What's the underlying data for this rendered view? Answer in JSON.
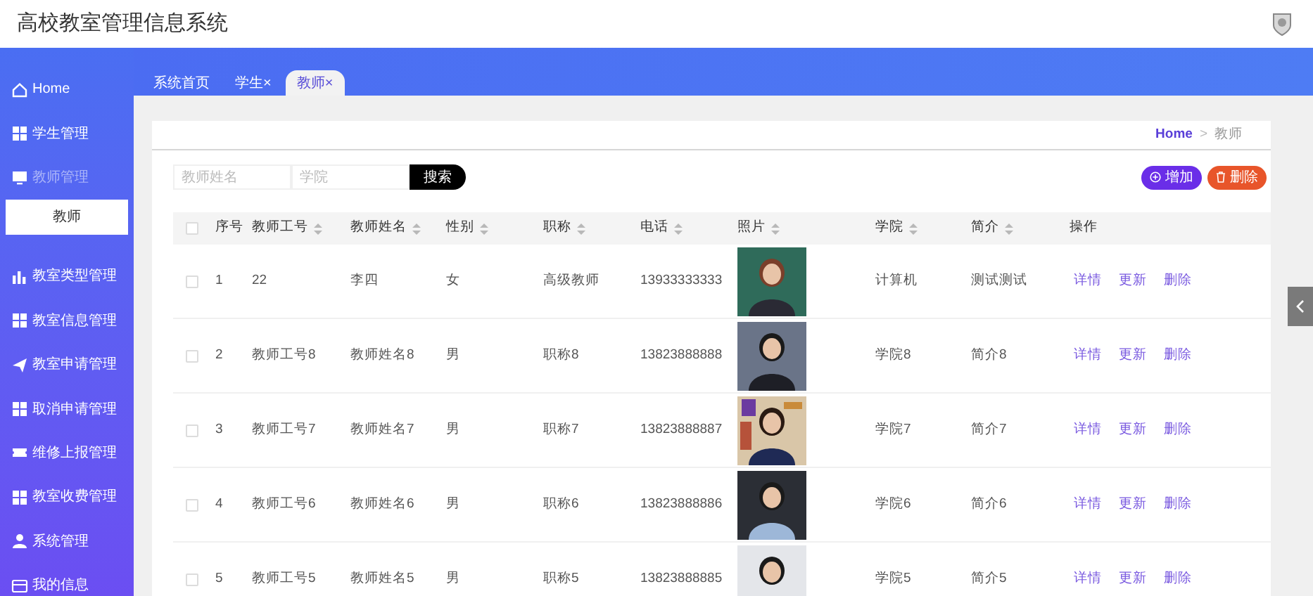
{
  "header": {
    "title": "高校教室管理信息系统"
  },
  "sidebar": {
    "items": [
      {
        "label": "Home",
        "expanded": false
      },
      {
        "label": "学生管理",
        "expanded": false
      },
      {
        "label": "教师管理",
        "expanded": true,
        "children": [
          {
            "label": "教师",
            "selected": true
          }
        ]
      },
      {
        "label": "教室类型管理",
        "expanded": false
      },
      {
        "label": "教室信息管理",
        "expanded": false
      },
      {
        "label": "教室申请管理",
        "expanded": false
      },
      {
        "label": "取消申请管理",
        "expanded": false
      },
      {
        "label": "维修上报管理",
        "expanded": false
      },
      {
        "label": "教室收费管理",
        "expanded": false
      },
      {
        "label": "系统管理",
        "expanded": false
      },
      {
        "label": "我的信息",
        "expanded": false
      }
    ]
  },
  "tabs": [
    {
      "label": "系统首页",
      "selected": false
    },
    {
      "label": "学生",
      "close": "×",
      "selected": false
    },
    {
      "label": "教师",
      "close": "×",
      "selected": true
    }
  ],
  "breadcrumb": {
    "home": "Home",
    "separator": ">",
    "current": "教师"
  },
  "search": {
    "fields": [
      {
        "placeholder": "教师姓名"
      },
      {
        "placeholder": "学院"
      }
    ],
    "button": "搜索"
  },
  "actions": {
    "add": "增加",
    "delete": "删除"
  },
  "table": {
    "header_checked": false,
    "columns": [
      {
        "label": "序号",
        "sortable": false
      },
      {
        "label": "教师工号",
        "sortable": true
      },
      {
        "label": "教师姓名",
        "sortable": true
      },
      {
        "label": "性别",
        "sortable": true
      },
      {
        "label": "职称",
        "sortable": true
      },
      {
        "label": "电话",
        "sortable": true
      },
      {
        "label": "照片",
        "sortable": true
      },
      {
        "label": "学院",
        "sortable": true
      },
      {
        "label": "简介",
        "sortable": true
      },
      {
        "label": "操作",
        "sortable": false
      }
    ],
    "rows": [
      {
        "checked": false,
        "index": "1",
        "id": "22",
        "name": "李四",
        "gender": "女",
        "title": "高级教师",
        "phone": "13933333333",
        "college": "计算机",
        "intro": "测试测试",
        "ops": [
          "详情",
          "更新",
          "删除"
        ]
      },
      {
        "checked": false,
        "index": "2",
        "id": "教师工号8",
        "name": "教师姓名8",
        "gender": "男",
        "title": "职称8",
        "phone": "13823888888",
        "college": "学院8",
        "intro": "简介8",
        "ops": [
          "详情",
          "更新",
          "删除"
        ]
      },
      {
        "checked": false,
        "index": "3",
        "id": "教师工号7",
        "name": "教师姓名7",
        "gender": "男",
        "title": "职称7",
        "phone": "13823888887",
        "college": "学院7",
        "intro": "简介7",
        "ops": [
          "详情",
          "更新",
          "删除"
        ]
      },
      {
        "checked": false,
        "index": "4",
        "id": "教师工号6",
        "name": "教师姓名6",
        "gender": "男",
        "title": "职称6",
        "phone": "13823888886",
        "college": "学院6",
        "intro": "简介6",
        "ops": [
          "详情",
          "更新",
          "删除"
        ]
      },
      {
        "checked": false,
        "index": "5",
        "id": "教师工号5",
        "name": "教师姓名5",
        "gender": "男",
        "title": "职称5",
        "phone": "13823888885",
        "college": "学院5",
        "intro": "简介5",
        "ops": [
          "详情",
          "更新",
          "删除"
        ]
      }
    ]
  }
}
